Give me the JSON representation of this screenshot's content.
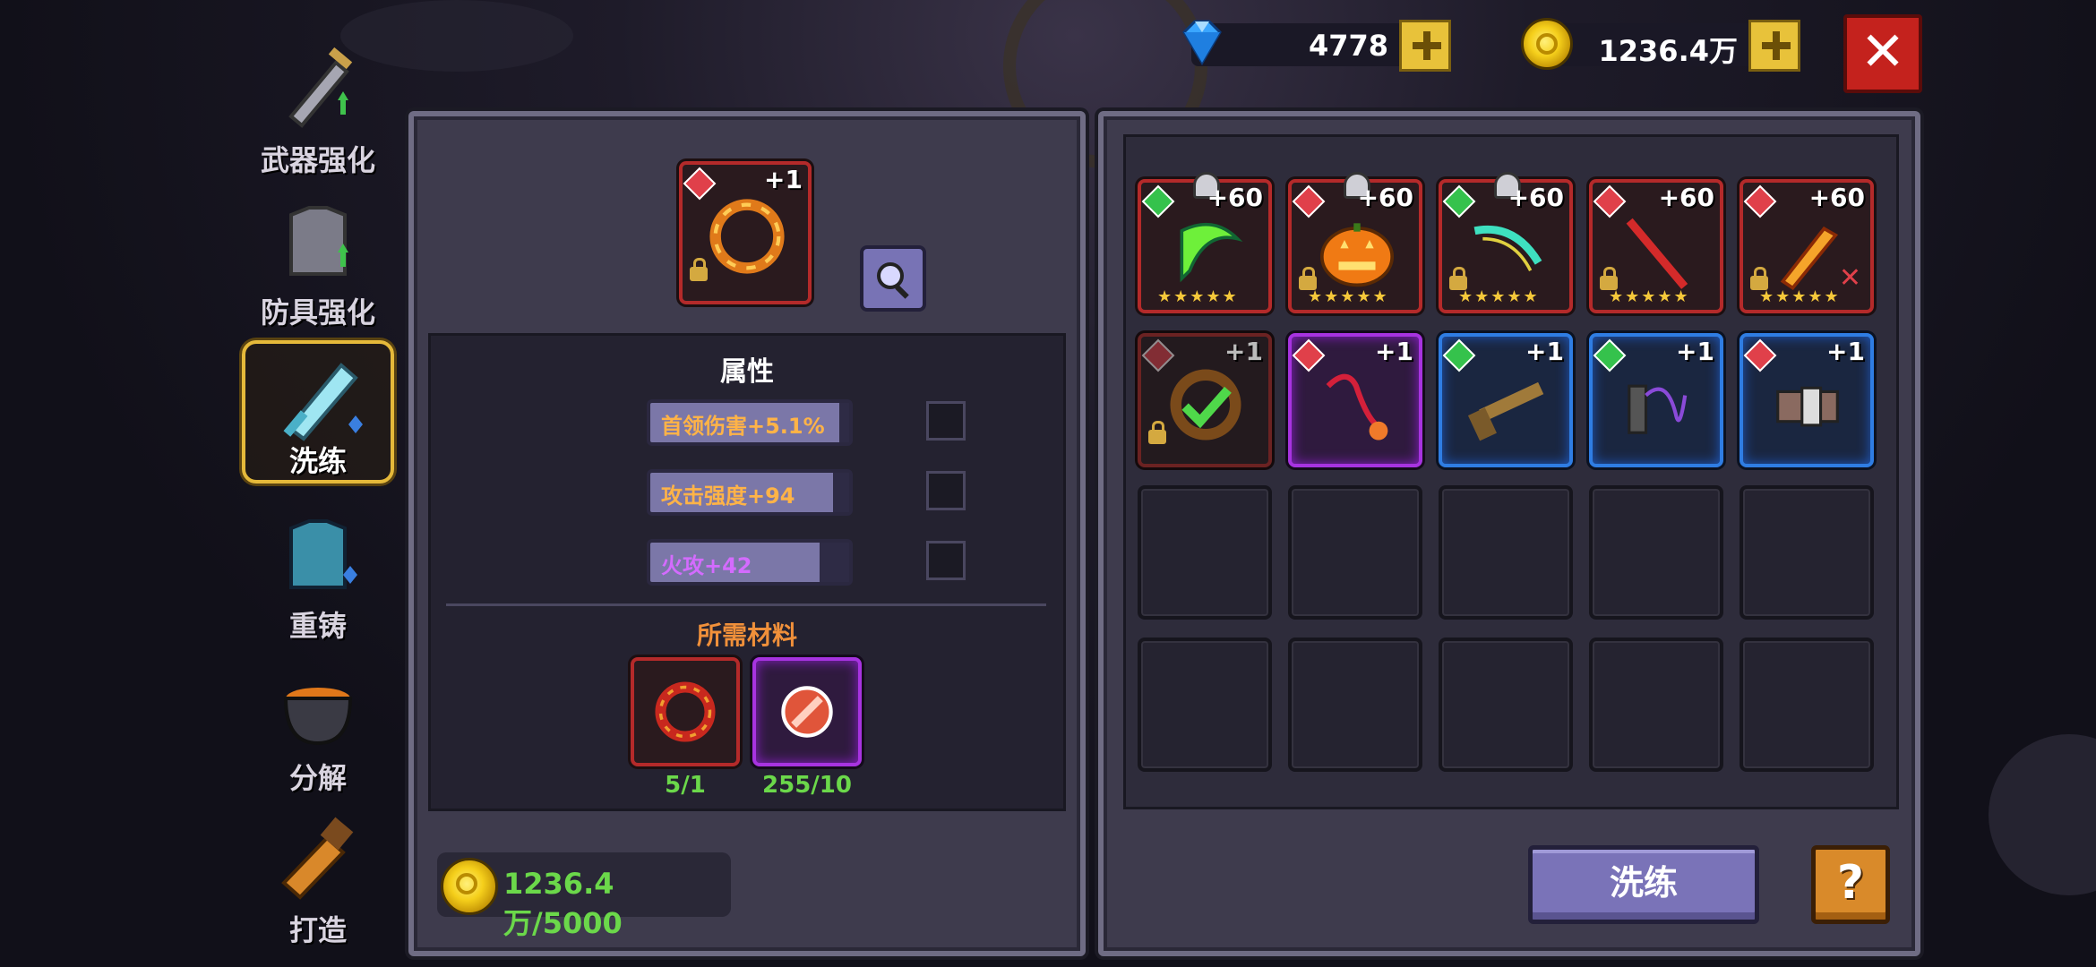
{
  "currency": {
    "gems": "4778",
    "coins": "1236.4万",
    "gem_color": "#3aa6ff",
    "coin_color": "#f5cf1b"
  },
  "sidebar": {
    "items": [
      {
        "label": "武器强化",
        "icon": "sword-upgrade-icon"
      },
      {
        "label": "防具强化",
        "icon": "armor-upgrade-icon"
      },
      {
        "label": "洗练",
        "icon": "reforge-crystal-sword-icon",
        "active": true
      },
      {
        "label": "重铸",
        "icon": "recast-armor-icon"
      },
      {
        "label": "分解",
        "icon": "cauldron-icon"
      },
      {
        "label": "打造",
        "icon": "forge-icon"
      }
    ]
  },
  "detail": {
    "selected_level": "+1",
    "attributes_title": "属性",
    "attributes": [
      {
        "text": "首领伤害+5.1%",
        "color": "#ffb347",
        "fill": 0.95
      },
      {
        "text": "攻击强度+94",
        "color": "#ffb347",
        "fill": 0.92
      },
      {
        "text": "火攻+42",
        "color": "#d46bff",
        "fill": 0.85
      }
    ],
    "materials_title": "所需材料",
    "materials": [
      {
        "count": "5/1",
        "type": "red"
      },
      {
        "count": "255/10",
        "type": "purple"
      }
    ],
    "cost": "1236.4万/5000"
  },
  "inventory": {
    "row1": [
      {
        "level": "+60",
        "elem": "green",
        "stars": "★★★★★",
        "pinned": true,
        "name": "green-scythe"
      },
      {
        "level": "+60",
        "elem": "red",
        "stars": "★★★★★",
        "pinned": true,
        "name": "pumpkin"
      },
      {
        "level": "+60",
        "elem": "green",
        "stars": "★★★★★",
        "pinned": true,
        "name": "jade-bow"
      },
      {
        "level": "+60",
        "elem": "red",
        "stars": "★★★★★",
        "pinned": false,
        "name": "red-spear"
      },
      {
        "level": "+60",
        "elem": "red",
        "stars": "★★★★★",
        "pinned": false,
        "name": "flame-sword"
      }
    ],
    "row2": [
      {
        "level": "+1",
        "elem": "red",
        "rarity": "dark",
        "name": "fire-ring-selected"
      },
      {
        "level": "+1",
        "elem": "red",
        "rarity": "purple",
        "name": "whip"
      },
      {
        "level": "+1",
        "elem": "green",
        "rarity": "blue",
        "name": "shotgun"
      },
      {
        "level": "+1",
        "elem": "green",
        "rarity": "blue",
        "name": "flail"
      },
      {
        "level": "+1",
        "elem": "red",
        "rarity": "blue",
        "name": "gauntlet"
      }
    ]
  },
  "buttons": {
    "reforge": "洗练",
    "help": "?",
    "close": "✕"
  }
}
